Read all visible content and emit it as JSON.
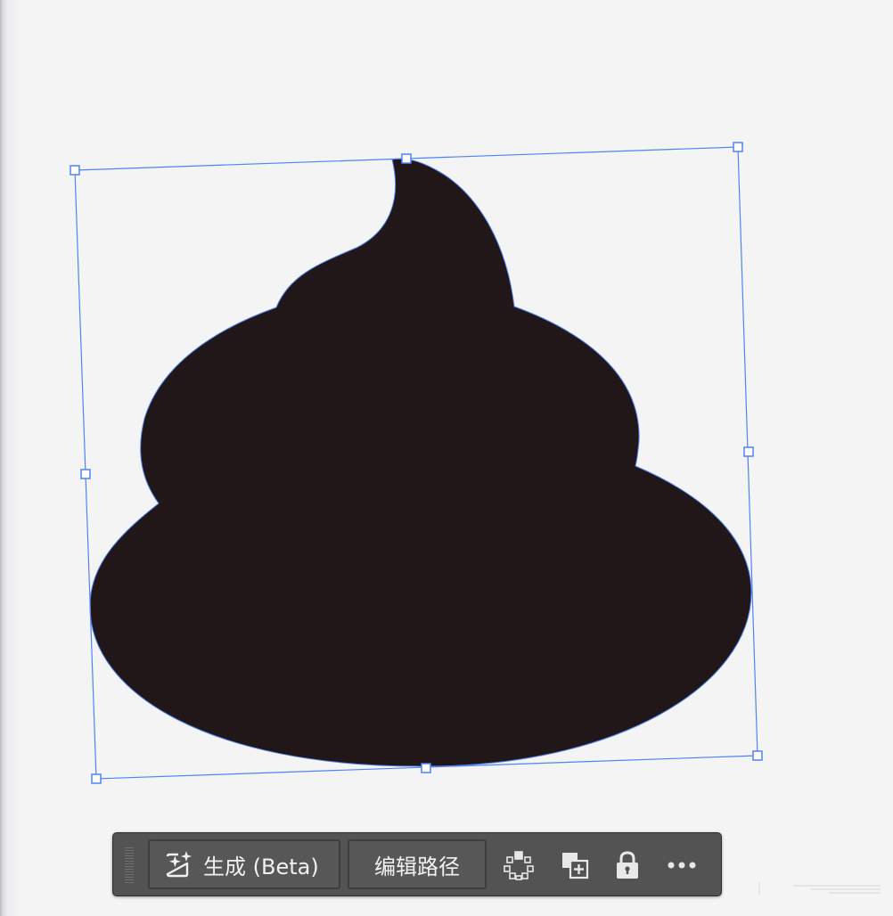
{
  "canvas": {
    "shape": {
      "name": "poop-shape",
      "fill": "#221718"
    },
    "selection": {
      "color": "#4f83f3",
      "handle_fill": "#ffffff"
    }
  },
  "toolbar": {
    "generate": {
      "label": "生成 (Beta)",
      "icon": "generate-sparkle-icon"
    },
    "edit_path": {
      "label": "编辑路径"
    },
    "icons": [
      "select-points-icon",
      "duplicate-add-icon",
      "lock-icon",
      "more-icon"
    ]
  },
  "colors": {
    "toolbar_bg": "#535353",
    "button_border": "#3e3e3e",
    "text": "#f1f1f1",
    "canvas_bg": "#f4f4f5"
  }
}
